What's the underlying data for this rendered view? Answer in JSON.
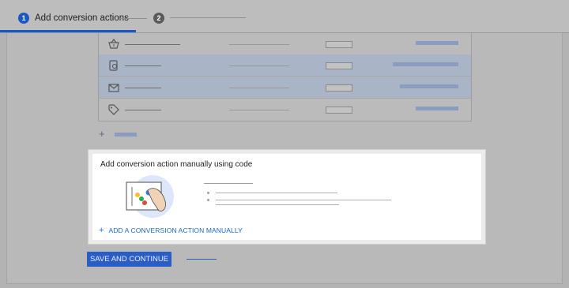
{
  "stepper": {
    "step1": {
      "number": "1",
      "label": "Add conversion actions"
    },
    "step2": {
      "number": "2"
    }
  },
  "card": {
    "title": "Add conversion action manually using code",
    "add_manual_link": "ADD A CONVERSION ACTION MANUALLY",
    "add_icon": "plus-icon"
  },
  "conversion_list": {
    "rows": [
      {
        "icon": "basket-icon",
        "selected": false
      },
      {
        "icon": "phone-icon",
        "selected": true
      },
      {
        "icon": "mail-icon",
        "selected": true
      },
      {
        "icon": "tag-icon",
        "selected": false
      }
    ],
    "add_icon": "plus-icon"
  },
  "actions": {
    "save_continue": "SAVE AND CONTINUE"
  },
  "colors": {
    "accent": "#1a57c6",
    "link": "#1a66d6",
    "overlay": "#b3b3b3"
  }
}
